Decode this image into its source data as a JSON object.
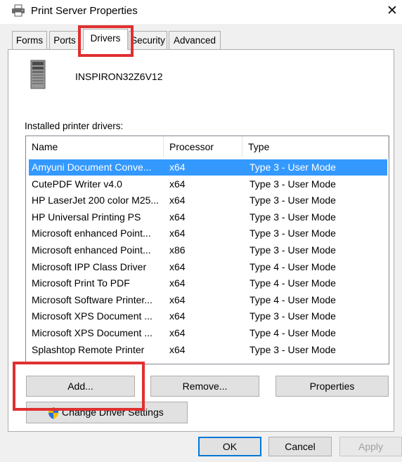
{
  "window": {
    "title": "Print Server Properties",
    "close_glyph": "✕"
  },
  "tabs": [
    {
      "label": "Forms"
    },
    {
      "label": "Ports"
    },
    {
      "label": "Drivers",
      "active": true
    },
    {
      "label": "Security"
    },
    {
      "label": "Advanced"
    }
  ],
  "server": {
    "name": "INSPIRON32Z6V12",
    "icon": "server-tower-icon"
  },
  "drivers": {
    "label": "Installed printer drivers:",
    "columns": [
      "Name",
      "Processor",
      "Type"
    ],
    "rows": [
      {
        "name": "Amyuni Document Conve...",
        "processor": "x64",
        "type": "Type 3 - User Mode",
        "selected": true
      },
      {
        "name": "CutePDF Writer v4.0",
        "processor": "x64",
        "type": "Type 3 - User Mode"
      },
      {
        "name": "HP LaserJet 200 color M25...",
        "processor": "x64",
        "type": "Type 3 - User Mode"
      },
      {
        "name": "HP Universal Printing PS",
        "processor": "x64",
        "type": "Type 3 - User Mode"
      },
      {
        "name": "Microsoft enhanced Point...",
        "processor": "x64",
        "type": "Type 3 - User Mode"
      },
      {
        "name": "Microsoft enhanced Point...",
        "processor": "x86",
        "type": "Type 3 - User Mode"
      },
      {
        "name": "Microsoft IPP Class Driver",
        "processor": "x64",
        "type": "Type 4 - User Mode"
      },
      {
        "name": "Microsoft Print To PDF",
        "processor": "x64",
        "type": "Type 4 - User Mode"
      },
      {
        "name": "Microsoft Software Printer...",
        "processor": "x64",
        "type": "Type 4 - User Mode"
      },
      {
        "name": "Microsoft XPS Document ...",
        "processor": "x64",
        "type": "Type 3 - User Mode"
      },
      {
        "name": "Microsoft XPS Document ...",
        "processor": "x64",
        "type": "Type 4 - User Mode"
      },
      {
        "name": "Splashtop Remote Printer",
        "processor": "x64",
        "type": "Type 3 - User Mode"
      }
    ]
  },
  "buttons": {
    "add": "Add...",
    "remove": "Remove...",
    "properties": "Properties",
    "change_settings": "Change Driver Settings",
    "ok": "OK",
    "cancel": "Cancel",
    "apply": "Apply"
  },
  "colors": {
    "selection": "#3399ff",
    "annotation": "#e03030",
    "default_button_border": "#0078d7"
  }
}
